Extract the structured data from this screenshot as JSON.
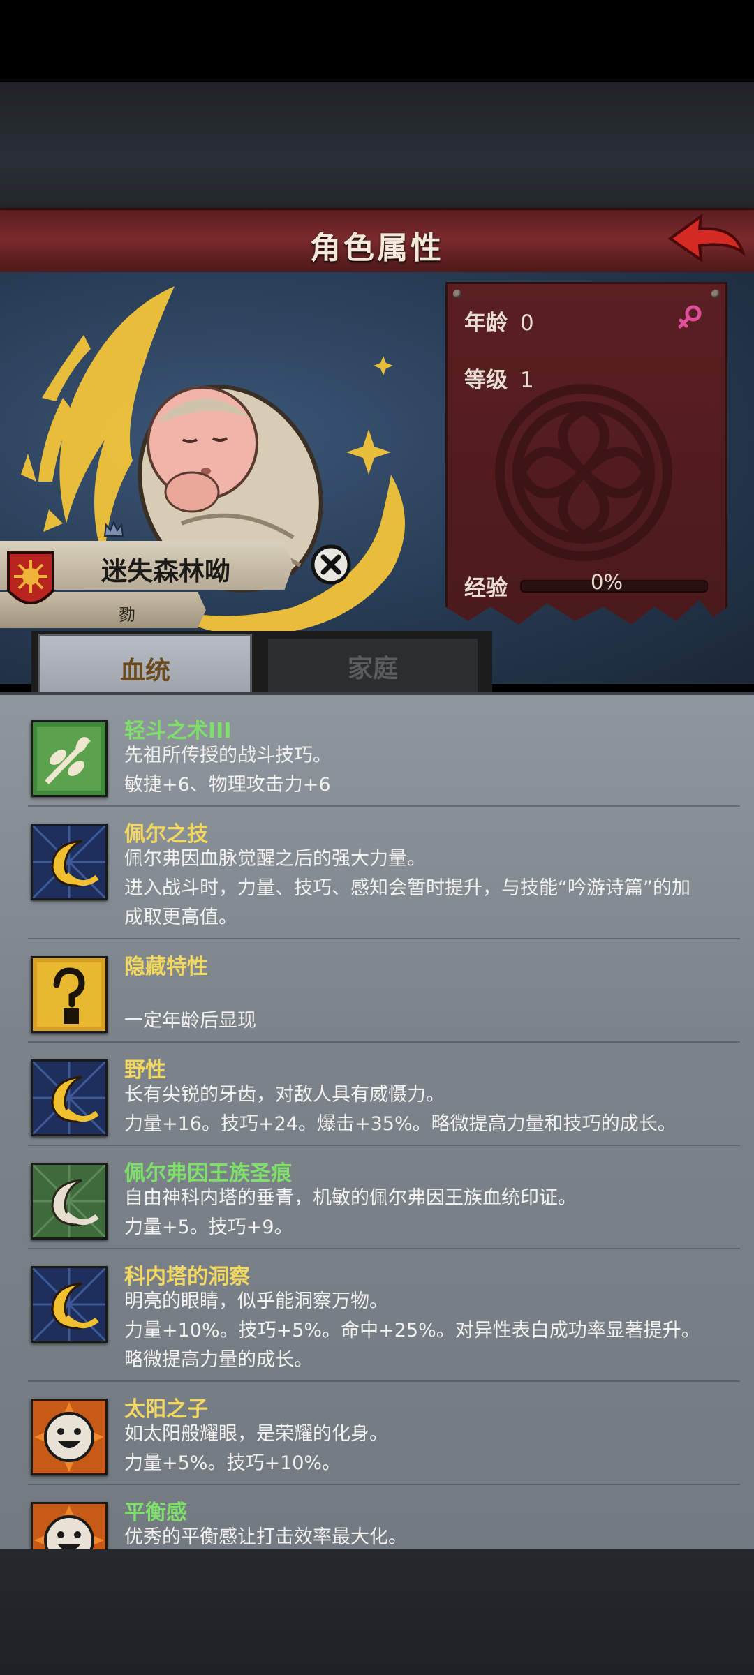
{
  "title": "角色属性",
  "character": {
    "name": "迷失森林呦",
    "subtitle": "勠"
  },
  "stats": {
    "age_label": "年龄",
    "age_value": "0",
    "level_label": "等级",
    "level_value": "1",
    "exp_label": "经验",
    "exp_value": "0%",
    "exp_fraction": 0,
    "gender": "female"
  },
  "tabs": [
    {
      "label": "血统",
      "active": true
    },
    {
      "label": "家庭",
      "active": false
    }
  ],
  "traits": [
    {
      "name": "轻斗之术III",
      "name_color": "#7ee06a",
      "icon": "leaf-branch-icon",
      "lines": [
        "先祖所传授的战斗技巧。",
        "敏捷+6、物理攻击力+6"
      ]
    },
    {
      "name": "佩尔之技",
      "name_color": "#f2d860",
      "icon": "crescent-moon-icon",
      "lines": [
        "佩尔弗因血脉觉醒之后的强大力量。",
        "进入战斗时，力量、技巧、感知会暂时提升，与技能“吟游诗篇”的加",
        "成取更高值。"
      ]
    },
    {
      "name": "隐藏特性",
      "name_color": "#f2d860",
      "icon": "question-mark-icon",
      "lines": [
        "",
        "一定年龄后显现"
      ]
    },
    {
      "name": "野性",
      "name_color": "#f2d860",
      "icon": "crescent-moon-icon",
      "lines": [
        "长有尖锐的牙齿，对敌人具有威慑力。",
        "力量+16。技巧+24。爆击+35%。略微提高力量和技巧的成长。"
      ]
    },
    {
      "name": "佩尔弗因王族圣痕",
      "name_color": "#7ee06a",
      "icon": "pale-crescent-icon",
      "lines": [
        "自由神科内塔的垂青，机敏的佩尔弗因王族血统印证。",
        "力量+5。技巧+9。"
      ]
    },
    {
      "name": "科内塔的洞察",
      "name_color": "#f2d860",
      "icon": "crescent-moon-icon",
      "lines": [
        "明亮的眼睛，似乎能洞察万物。",
        "力量+10%。技巧+5%。命中+25%。对异性表白成功率显著提升。",
        "略微提高力量的成长。"
      ]
    },
    {
      "name": "太阳之子",
      "name_color": "#f2d860",
      "icon": "smiley-sun-icon",
      "lines": [
        "如太阳般耀眼，是荣耀的化身。",
        "力量+5%。技巧+10%。"
      ]
    },
    {
      "name": "平衡感",
      "name_color": "#7ee06a",
      "icon": "smiley-sun-icon",
      "lines": [
        "优秀的平衡感让打击效率最大化。"
      ]
    }
  ]
}
